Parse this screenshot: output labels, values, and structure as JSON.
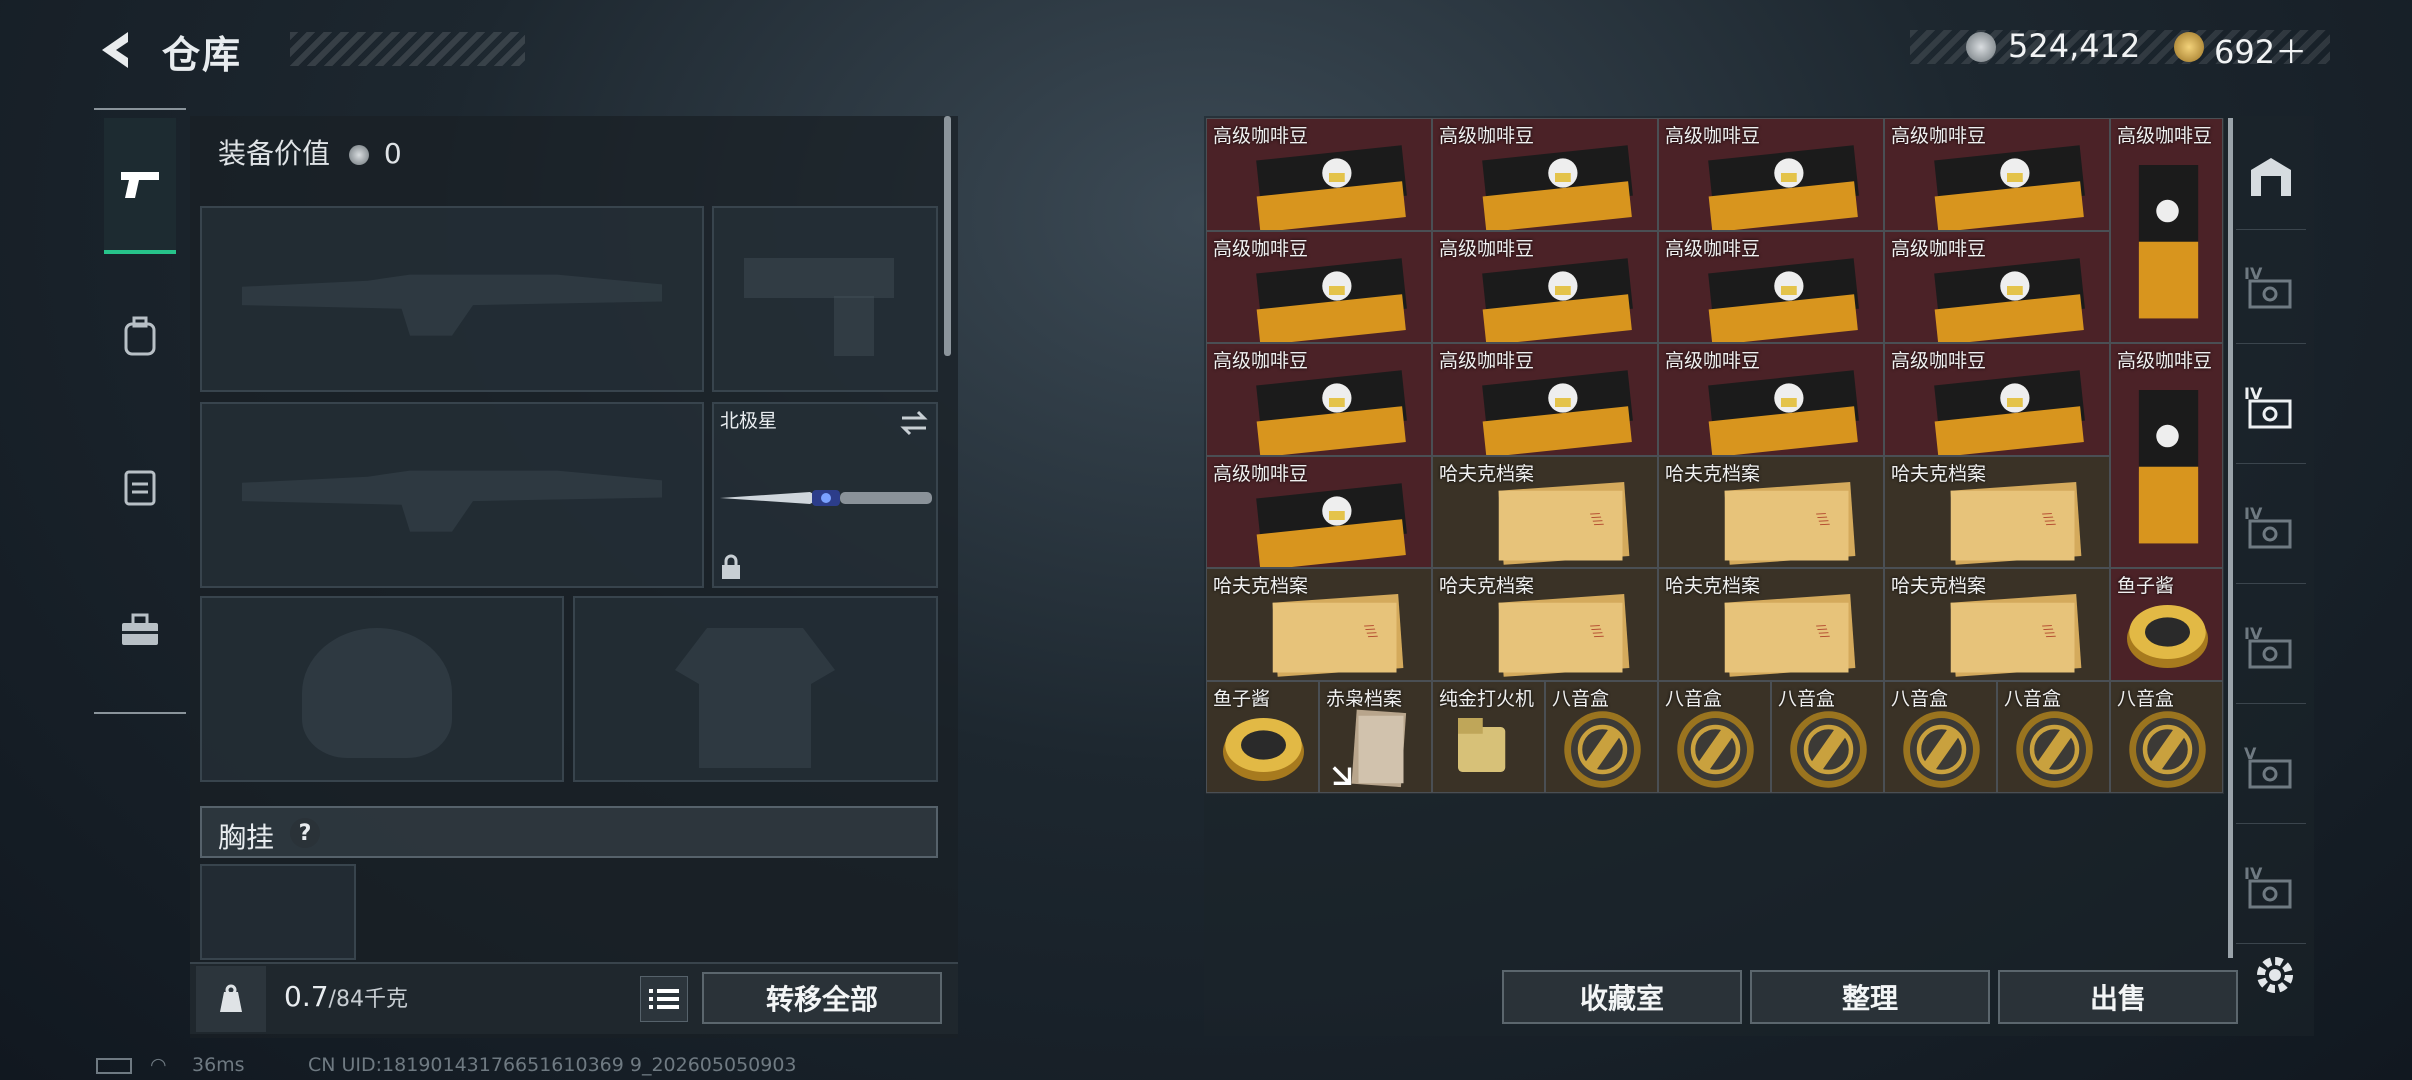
{
  "header": {
    "title": "仓库",
    "currency_silver": "524,412",
    "currency_gold": "692＋"
  },
  "equipment": {
    "value_label": "装备价值",
    "value": "0",
    "melee_slot_name": "北极星",
    "chest_label": "胸挂",
    "chest_help": "?"
  },
  "footer": {
    "weight": "0.7",
    "weight_capacity": "/84千克",
    "transfer_all": "转移全部"
  },
  "grid": {
    "items": [
      {
        "name": "高级咖啡豆",
        "type": "coffee",
        "bg": "red"
      },
      {
        "name": "高级咖啡豆",
        "type": "coffee",
        "bg": "red"
      },
      {
        "name": "高级咖啡豆",
        "type": "coffee",
        "bg": "red"
      },
      {
        "name": "高级咖啡豆",
        "type": "coffee",
        "bg": "red"
      },
      {
        "name": "高级咖啡豆",
        "type": "coffee-tall",
        "bg": "red"
      },
      {
        "name": "高级咖啡豆",
        "type": "coffee",
        "bg": "red"
      },
      {
        "name": "高级咖啡豆",
        "type": "coffee",
        "bg": "red"
      },
      {
        "name": "高级咖啡豆",
        "type": "coffee",
        "bg": "red"
      },
      {
        "name": "高级咖啡豆",
        "type": "coffee",
        "bg": "red"
      },
      {
        "name": "高级咖啡豆",
        "type": "coffee",
        "bg": "red"
      },
      {
        "name": "高级咖啡豆",
        "type": "coffee",
        "bg": "red"
      },
      {
        "name": "高级咖啡豆",
        "type": "coffee",
        "bg": "red"
      },
      {
        "name": "高级咖啡豆",
        "type": "coffee",
        "bg": "red"
      },
      {
        "name": "高级咖啡豆",
        "type": "coffee-tall",
        "bg": "red"
      },
      {
        "name": "高级咖啡豆",
        "type": "coffee",
        "bg": "red"
      },
      {
        "name": "哈夫克档案",
        "type": "file",
        "bg": "brown"
      },
      {
        "name": "哈夫克档案",
        "type": "file",
        "bg": "brown"
      },
      {
        "name": "哈夫克档案",
        "type": "file",
        "bg": "brown"
      },
      {
        "name": "哈夫克档案",
        "type": "file",
        "bg": "brown"
      },
      {
        "name": "哈夫克档案",
        "type": "file",
        "bg": "brown"
      },
      {
        "name": "哈夫克档案",
        "type": "file",
        "bg": "brown"
      },
      {
        "name": "哈夫克档案",
        "type": "file",
        "bg": "brown"
      },
      {
        "name": "鱼子酱",
        "type": "caviar",
        "bg": "red"
      },
      {
        "name": "鱼子酱",
        "type": "caviar",
        "bg": "brown"
      },
      {
        "name": "赤枭档案",
        "type": "notes",
        "bg": "brown"
      },
      {
        "name": "纯金打火机",
        "type": "lighter",
        "bg": "brown"
      },
      {
        "name": "八音盒",
        "type": "musicbox",
        "bg": "brown"
      },
      {
        "name": "八音盒",
        "type": "musicbox",
        "bg": "brown"
      },
      {
        "name": "八音盒",
        "type": "musicbox",
        "bg": "brown"
      },
      {
        "name": "八音盒",
        "type": "musicbox",
        "bg": "brown"
      },
      {
        "name": "八音盒",
        "type": "musicbox",
        "bg": "brown"
      },
      {
        "name": "八音盒",
        "type": "musicbox",
        "bg": "brown"
      }
    ]
  },
  "actions": {
    "collection": "收藏室",
    "sort": "整理",
    "sell": "出售"
  },
  "status": {
    "ping": "36ms",
    "uid": "CN UID:18190143176651610369 9_202605050903"
  },
  "side_categories": [
    "IV",
    "IV",
    "IV",
    "IV",
    "V",
    "IV"
  ],
  "colors": {
    "accent_green": "#27c38a",
    "item_red": "#4b2227"
  }
}
